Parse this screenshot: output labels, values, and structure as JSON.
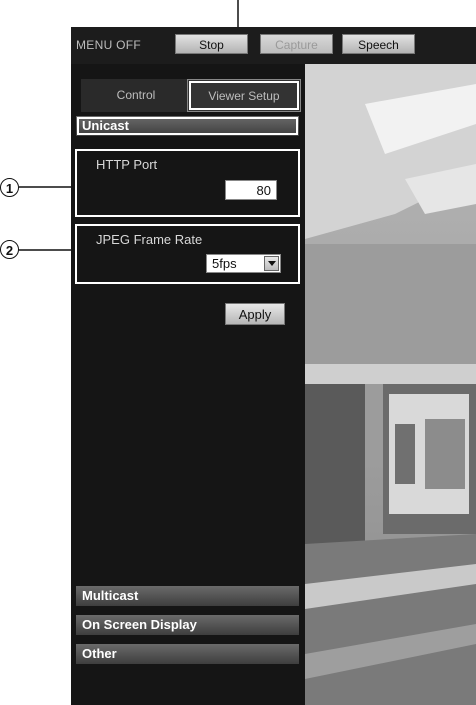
{
  "toolbar": {
    "menu_off": "MENU OFF",
    "stop": "Stop",
    "capture": "Capture",
    "speech": "Speech"
  },
  "tabs": {
    "control": "Control",
    "viewer_setup": "Viewer Setup"
  },
  "unicast": {
    "heading": "Unicast",
    "http_port_label": "HTTP Port",
    "http_port_value": "80",
    "jpeg_frame_rate_label": "JPEG Frame Rate",
    "jpeg_frame_rate_value": "5fps",
    "apply": "Apply"
  },
  "sections": {
    "multicast": "Multicast",
    "osd": "On Screen Display",
    "other": "Other"
  },
  "callouts": {
    "one": "1",
    "two": "2"
  }
}
